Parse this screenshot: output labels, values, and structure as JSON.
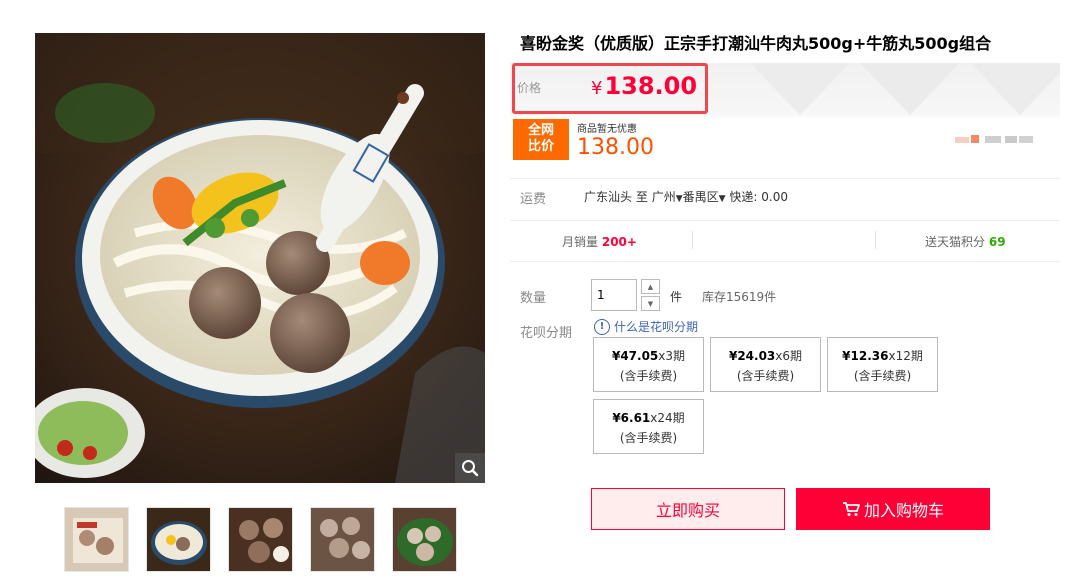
{
  "product": {
    "title": "喜盼金奖（优质版）正宗手打潮汕牛肉丸500g+牛筋丸500g组合"
  },
  "price": {
    "label": "价格",
    "currency": "¥",
    "value": "138.00",
    "compare_badge_line1": "全网",
    "compare_badge_line2": "比价",
    "compare_note": "商品暂无优惠",
    "compare_value": "138.00"
  },
  "shipping": {
    "label": "运费",
    "origin": "广东汕头",
    "to": "至",
    "city": "广州",
    "district": "番禺区",
    "method": "快递: 0.00"
  },
  "stats": {
    "monthly_sales_label": "月销量",
    "monthly_sales_value": "200+",
    "points_label": "送天猫积分",
    "points_value": "69"
  },
  "quantity": {
    "label": "数量",
    "value": "1",
    "unit": "件",
    "stock": "库存15619件"
  },
  "installments": {
    "label": "花呗分期",
    "help_link": "什么是花呗分期",
    "options": [
      {
        "amount": "¥47.05",
        "periods": "x3期",
        "fee": "(含手续费)"
      },
      {
        "amount": "¥24.03",
        "periods": "x6期",
        "fee": "(含手续费)"
      },
      {
        "amount": "¥12.36",
        "periods": "x12期",
        "fee": "(含手续费)"
      },
      {
        "amount": "¥6.61",
        "periods": "x24期",
        "fee": "(含手续费)"
      }
    ]
  },
  "actions": {
    "buy_now": "立即购买",
    "add_to_cart": "加入购物车"
  },
  "colors": {
    "accent": "#ff0036",
    "orange": "#ff6a00",
    "link": "#3d64b5",
    "points": "#33aa00"
  },
  "icons": [
    "zoom-icon",
    "info-icon",
    "cart-icon",
    "chevron-down-icon"
  ]
}
